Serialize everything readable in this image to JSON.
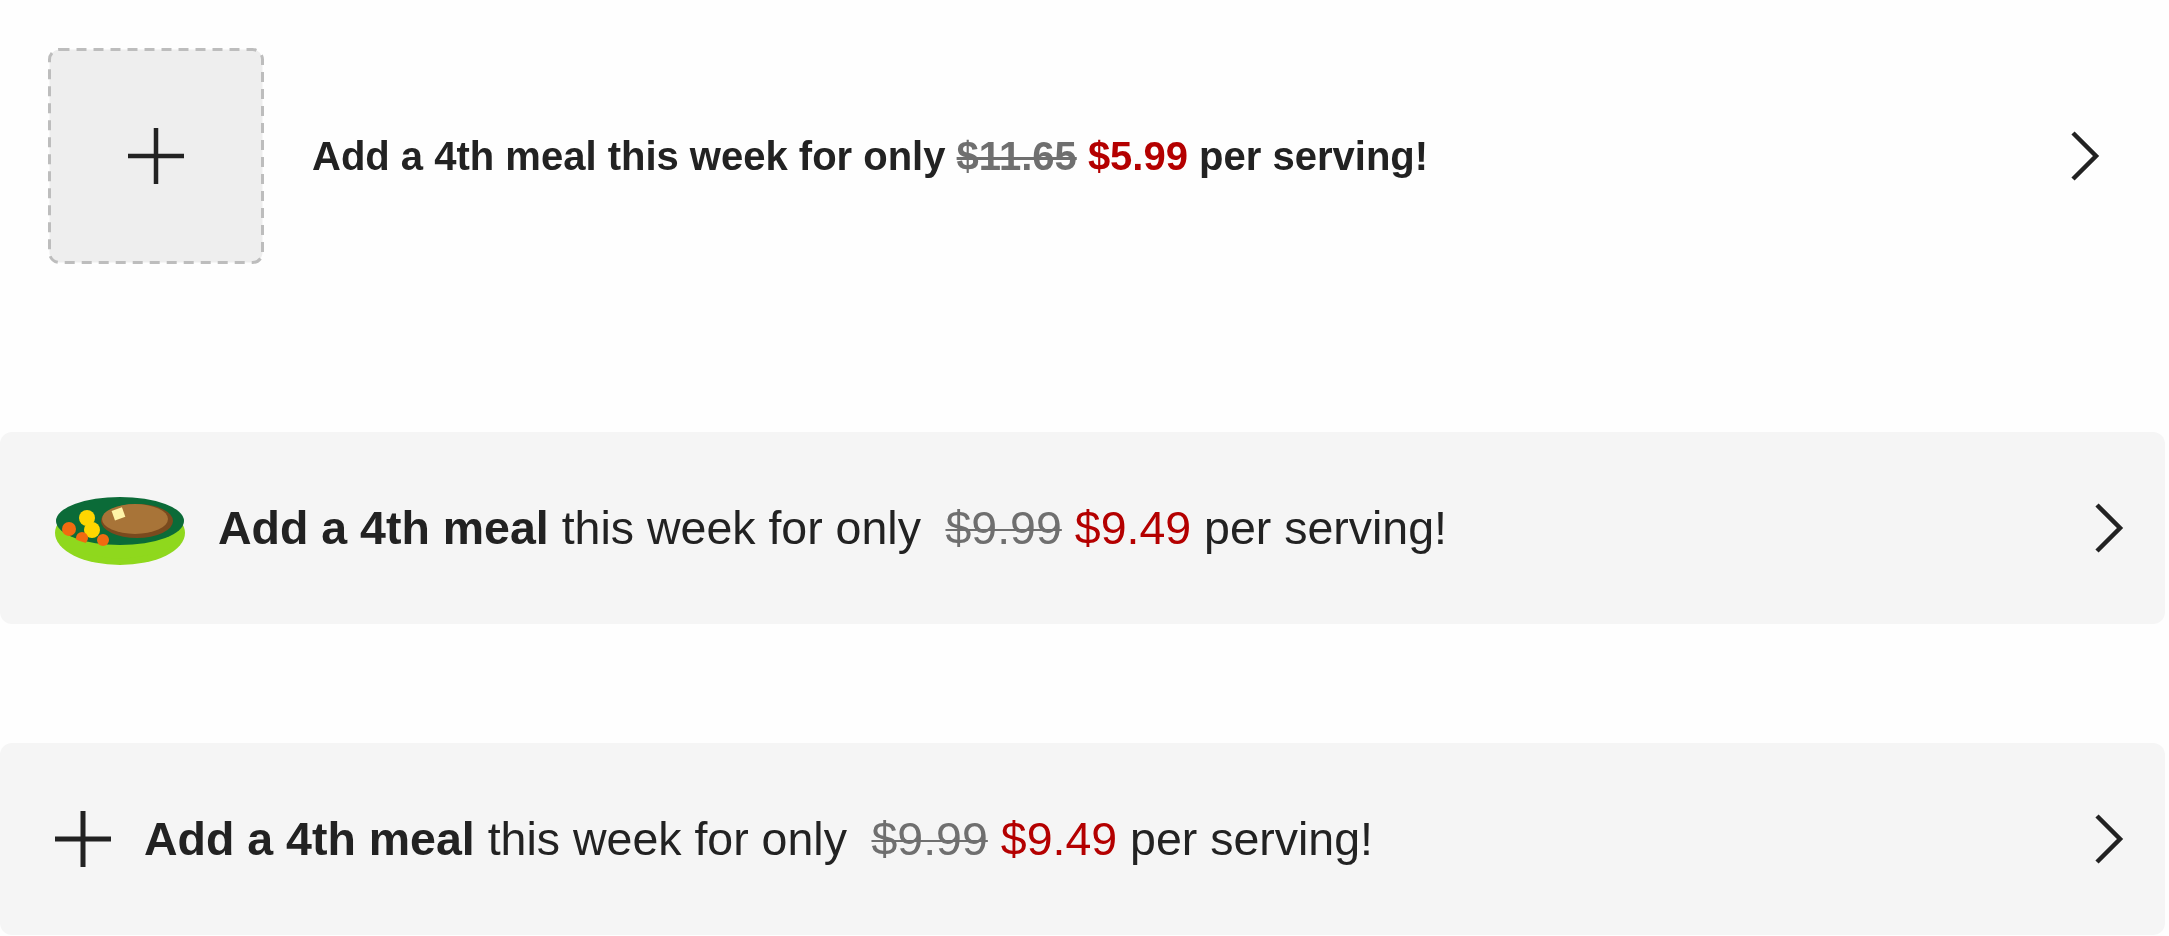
{
  "offers": [
    {
      "kind": "tile",
      "message": "Add a 4th meal this week for only",
      "old_price": "$11.65",
      "new_price": "$5.99",
      "suffix": "per serving!"
    },
    {
      "kind": "dish",
      "message": "**Add a 4th meal** this week for only",
      "old_price": "$9.99",
      "new_price": "$9.49",
      "suffix": "per serving!"
    },
    {
      "kind": "plus",
      "message": "**Add a 4th meal** this week for only",
      "old_price": "$9.99",
      "new_price": "$9.49",
      "suffix": "per serving!"
    }
  ]
}
